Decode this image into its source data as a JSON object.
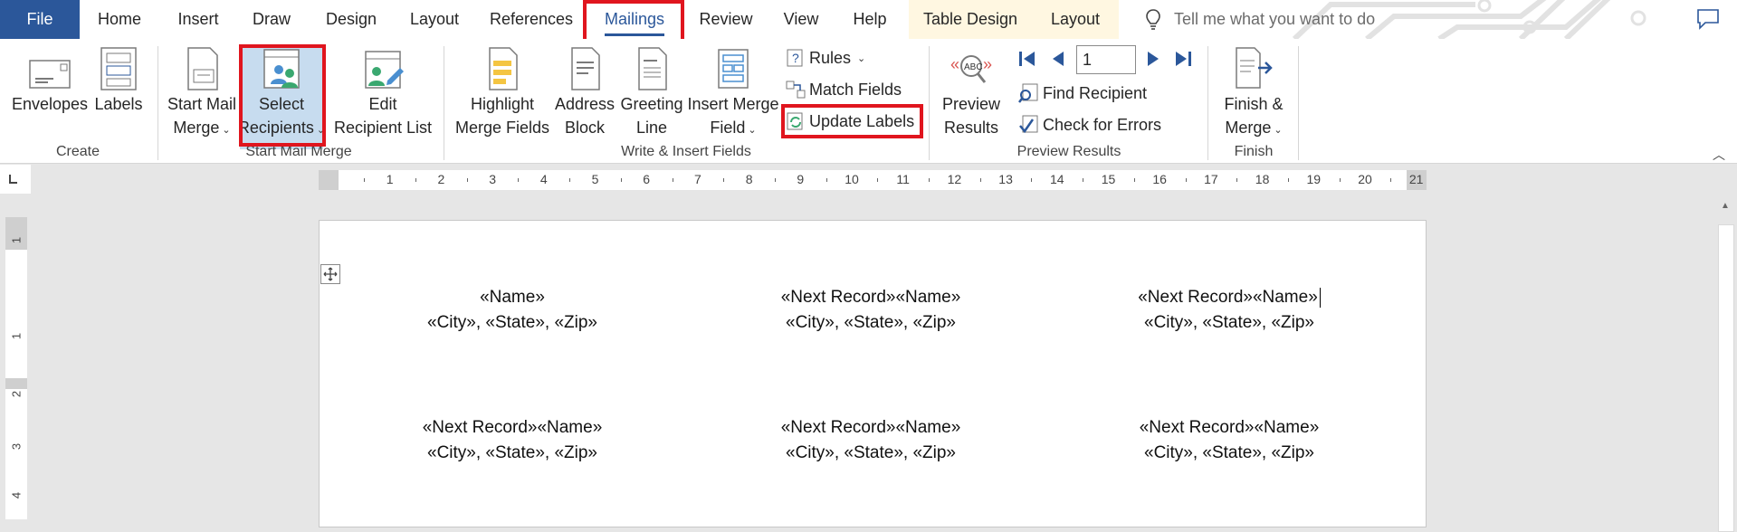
{
  "tabs": [
    {
      "label": "File"
    },
    {
      "label": "Home"
    },
    {
      "label": "Insert"
    },
    {
      "label": "Draw"
    },
    {
      "label": "Design"
    },
    {
      "label": "Layout"
    },
    {
      "label": "References"
    },
    {
      "label": "Mailings"
    },
    {
      "label": "Review"
    },
    {
      "label": "View"
    },
    {
      "label": "Help"
    },
    {
      "label": "Table Design"
    },
    {
      "label": "Layout"
    }
  ],
  "active_tab": "Mailings",
  "search": {
    "placeholder": "Tell me what you want to do"
  },
  "ribbon": {
    "create": {
      "label": "Create",
      "envelopes": "Envelopes",
      "labels": "Labels"
    },
    "start_mail_merge": {
      "label": "Start Mail Merge",
      "start_line1": "Start Mail",
      "start_line2": "Merge",
      "select_line1": "Select",
      "select_line2": "Recipients",
      "edit_line1": "Edit",
      "edit_line2": "Recipient List"
    },
    "write_insert": {
      "label": "Write & Insert Fields",
      "highlight_line1": "Highlight",
      "highlight_line2": "Merge Fields",
      "address_line1": "Address",
      "address_line2": "Block",
      "greeting_line1": "Greeting",
      "greeting_line2": "Line",
      "insert_line1": "Insert Merge",
      "insert_line2": "Field",
      "rules": "Rules",
      "match_fields": "Match Fields",
      "update_labels": "Update Labels"
    },
    "preview": {
      "label": "Preview Results",
      "preview_line1": "Preview",
      "preview_line2": "Results",
      "record_value": "1",
      "find_recipient": "Find Recipient",
      "check_errors": "Check for Errors"
    },
    "finish": {
      "label": "Finish",
      "finish_line1": "Finish &",
      "finish_line2": "Merge"
    }
  },
  "ruler": {
    "h_numbers": [
      "1",
      "2",
      "3",
      "4",
      "5",
      "6",
      "7",
      "8",
      "9",
      "10",
      "11",
      "12",
      "13",
      "14",
      "15",
      "16",
      "17",
      "18",
      "19",
      "20",
      "21"
    ],
    "v_numbers": [
      "1",
      "1",
      "2",
      "3",
      "4"
    ]
  },
  "labels_grid": [
    [
      {
        "line1": "«Name»",
        "line2": "«City», «State», «Zip»"
      },
      {
        "line1": "«Next Record»«Name»",
        "line2": "«City», «State», «Zip»"
      },
      {
        "line1": "«Next Record»«Name»",
        "line2": "«City», «State», «Zip»"
      }
    ],
    [
      {
        "line1": "«Next Record»«Name»",
        "line2": "«City», «State», «Zip»"
      },
      {
        "line1": "«Next Record»«Name»",
        "line2": "«City», «State», «Zip»"
      },
      {
        "line1": "«Next Record»«Name»",
        "line2": "«City», «State», «Zip»"
      }
    ]
  ],
  "colors": {
    "accent": "#2b579a",
    "highlight_box": "#e0151e",
    "contextual_tab_bg": "#fff7e1",
    "selected_button_bg": "#c7dcef"
  }
}
